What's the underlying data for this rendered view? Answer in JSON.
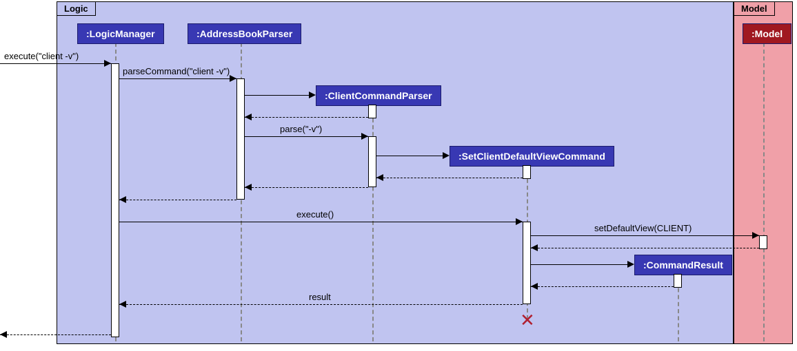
{
  "frames": {
    "logic": {
      "label": "Logic"
    },
    "model": {
      "label": "Model"
    }
  },
  "participants": {
    "logicManager": ":LogicManager",
    "addressBookParser": ":AddressBookParser",
    "clientCommandParser": ":ClientCommandParser",
    "setClientDefaultViewCommand": ":SetClientDefaultViewCommand",
    "commandResult": ":CommandResult",
    "model": ":Model"
  },
  "messages": {
    "executeEntry": "execute(\"client -v\")",
    "parseCommand": "parseCommand(\"client -v\")",
    "parse": "parse(\"-v\")",
    "executeCall": "execute()",
    "setDefaultView": "setDefaultView(CLIENT)",
    "result": "result"
  },
  "chart_data": {
    "type": "sequence_diagram",
    "frames": [
      {
        "name": "Logic",
        "participants": [
          ":LogicManager",
          ":AddressBookParser",
          ":ClientCommandParser",
          ":SetClientDefaultViewCommand",
          ":CommandResult"
        ]
      },
      {
        "name": "Model",
        "participants": [
          ":Model"
        ]
      }
    ],
    "messages": [
      {
        "from": "caller",
        "to": ":LogicManager",
        "label": "execute(\"client -v\")",
        "type": "sync"
      },
      {
        "from": ":LogicManager",
        "to": ":AddressBookParser",
        "label": "parseCommand(\"client -v\")",
        "type": "sync"
      },
      {
        "from": ":AddressBookParser",
        "to": ":ClientCommandParser",
        "label": "",
        "type": "create"
      },
      {
        "from": ":ClientCommandParser",
        "to": ":AddressBookParser",
        "label": "",
        "type": "return"
      },
      {
        "from": ":AddressBookParser",
        "to": ":ClientCommandParser",
        "label": "parse(\"-v\")",
        "type": "sync"
      },
      {
        "from": ":ClientCommandParser",
        "to": ":SetClientDefaultViewCommand",
        "label": "",
        "type": "create"
      },
      {
        "from": ":SetClientDefaultViewCommand",
        "to": ":ClientCommandParser",
        "label": "",
        "type": "return"
      },
      {
        "from": ":ClientCommandParser",
        "to": ":AddressBookParser",
        "label": "",
        "type": "return"
      },
      {
        "from": ":AddressBookParser",
        "to": ":LogicManager",
        "label": "",
        "type": "return"
      },
      {
        "from": ":LogicManager",
        "to": ":SetClientDefaultViewCommand",
        "label": "execute()",
        "type": "sync"
      },
      {
        "from": ":SetClientDefaultViewCommand",
        "to": ":Model",
        "label": "setDefaultView(CLIENT)",
        "type": "sync"
      },
      {
        "from": ":Model",
        "to": ":SetClientDefaultViewCommand",
        "label": "",
        "type": "return"
      },
      {
        "from": ":SetClientDefaultViewCommand",
        "to": ":CommandResult",
        "label": "",
        "type": "create"
      },
      {
        "from": ":CommandResult",
        "to": ":SetClientDefaultViewCommand",
        "label": "",
        "type": "return"
      },
      {
        "from": ":SetClientDefaultViewCommand",
        "to": ":LogicManager",
        "label": "result",
        "type": "return"
      },
      {
        "from": ":SetClientDefaultViewCommand",
        "action": "destroy"
      },
      {
        "from": ":LogicManager",
        "to": "caller",
        "label": "",
        "type": "return"
      }
    ]
  }
}
